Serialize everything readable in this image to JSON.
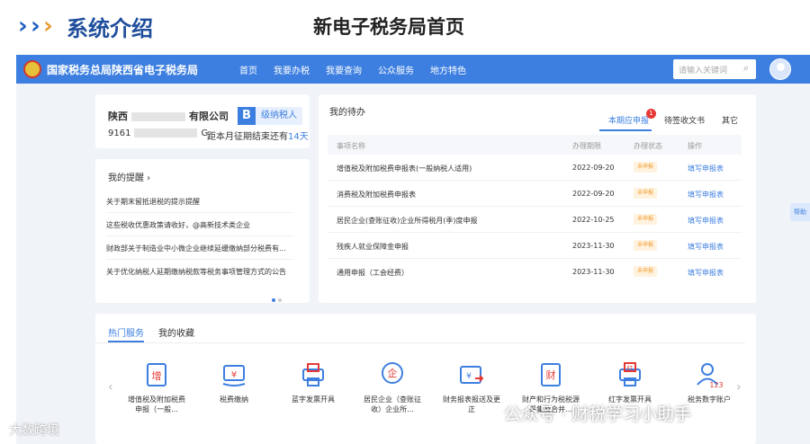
{
  "slide": {
    "title": "系统介绍",
    "subtitle": "新电子税务局首页"
  },
  "topbar": {
    "site_name": "国家税务总局陕西省电子税务局",
    "nav": [
      "首页",
      "我要办税",
      "我要查询",
      "公众服务",
      "地方特色"
    ],
    "search_placeholder": "请输入关键词",
    "accent_color": "#3d7fe0"
  },
  "taxpayer": {
    "name_prefix": "陕西",
    "name_suffix": "有限公司",
    "tax_id_prefix": "9161",
    "tax_id_suffix": "G",
    "badge_letter": "B",
    "badge_label": "级纳税人",
    "deadline_prefix": "距本月征期结束还有",
    "deadline_days": "14天"
  },
  "reminders": {
    "title": "我的提醒 ›",
    "items": [
      "关于期末留抵退税的提示提醒",
      "这些税收优惠政策请收好，@高新技术类企业",
      "财政部关于制造业中小微企业继续延缓缴纳部分税费有...",
      "关于优化纳税人延期缴纳税款等税务事项管理方式的公告"
    ]
  },
  "todo": {
    "title": "我的待办",
    "tabs": [
      "本期应申报",
      "待签收文书",
      "其它"
    ],
    "badge_count": "1",
    "columns": [
      "事项名称",
      "办理期限",
      "办理状态",
      "操作"
    ],
    "rows": [
      {
        "name": "增值税及附加税费申报表(一般纳税人适用)",
        "deadline": "2022-09-20",
        "status": "未申报",
        "action": "填写申报表"
      },
      {
        "name": "消费税及附加税费申报表",
        "deadline": "2022-09-20",
        "status": "未申报",
        "action": "填写申报表"
      },
      {
        "name": "居民企业(查账征收)企业所得税月(季)度申报",
        "deadline": "2022-10-25",
        "status": "未申报",
        "action": "填写申报表"
      },
      {
        "name": "残疾人就业保障金申报",
        "deadline": "2023-11-30",
        "status": "未申报",
        "action": "填写申报表"
      },
      {
        "name": "通用申报（工会经费）",
        "deadline": "2023-11-30",
        "status": "未申报",
        "action": "填写申报表"
      }
    ]
  },
  "services": {
    "tabs": [
      "热门服务",
      "我的收藏"
    ],
    "items": [
      {
        "label": "增值税及附加税费申报（一般...",
        "icon": "vat-declare-icon"
      },
      {
        "label": "税费缴纳",
        "icon": "tax-payment-icon"
      },
      {
        "label": "蓝字发票开具",
        "icon": "blue-invoice-icon"
      },
      {
        "label": "居民企业（查账征收）企业所...",
        "icon": "enterprise-income-tax-icon"
      },
      {
        "label": "财务报表报送及更正",
        "icon": "financial-report-icon"
      },
      {
        "label": "财产和行为税税源采集及合并...",
        "icon": "property-tax-icon"
      },
      {
        "label": "红字发票开具",
        "icon": "red-invoice-icon"
      },
      {
        "label": "税务数字账户",
        "icon": "digital-account-icon"
      }
    ]
  },
  "side_tab": "帮助",
  "watermarks": {
    "left": "大数跨境",
    "right": "公众号 · 财税学习小助手"
  }
}
